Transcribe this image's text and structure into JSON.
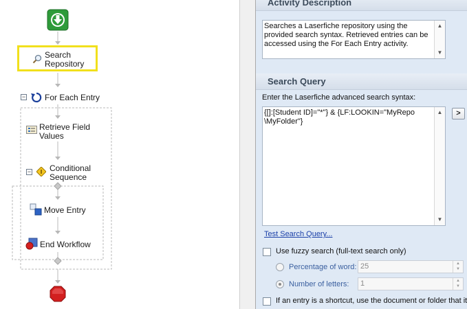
{
  "workflow": {
    "nodes": [
      {
        "name": "start",
        "label": ""
      },
      {
        "name": "search-repository",
        "label_line1": "Search",
        "label_line2": "Repository"
      },
      {
        "name": "for-each-entry",
        "label": "For Each Entry"
      },
      {
        "name": "retrieve-field-values",
        "label_line1": "Retrieve Field",
        "label_line2": "Values"
      },
      {
        "name": "conditional-sequence",
        "label_line1": "Conditional",
        "label_line2": "Sequence"
      },
      {
        "name": "move-entry",
        "label": "Move Entry"
      },
      {
        "name": "end-workflow",
        "label": "End Workflow"
      },
      {
        "name": "stop",
        "label": ""
      }
    ],
    "icons": {
      "start": "green-down-arrow-icon",
      "search": "magnifier-icon",
      "for_each": "loop-icon",
      "retrieve": "field-list-icon",
      "conditional": "diamond-condition-icon",
      "move": "move-entry-icon",
      "end": "end-workflow-icon",
      "stop": "red-octagon-stop-icon"
    },
    "colors": {
      "selection": "#f1e01c",
      "start": "#2e9b3a",
      "stop": "#d21f1f"
    }
  },
  "properties": {
    "activity_description": {
      "header": "Activity Description",
      "text": "Searches a Laserfiche repository using the provided search syntax.  Retrieved entries can be accessed using the For Each Entry activity."
    },
    "search_query": {
      "header": "Search Query",
      "prompt": "Enter the Laserfiche advanced search syntax:",
      "query_line1": "{[]:[Student ID]=\"*\"} & {LF:LOOKIN=\"MyRepo",
      "query_line2": "\\MyFolder\"}",
      "expand_button": ">",
      "test_link": "Test Search Query...",
      "fuzzy_label": "Use fuzzy search (full-text search only)",
      "percentage_label": "Percentage of word:",
      "percentage_value": "25",
      "letters_label": "Number of letters:",
      "letters_value": "1",
      "shortcut_label": "If an entry is a shortcut, use the document or folder that it"
    }
  }
}
